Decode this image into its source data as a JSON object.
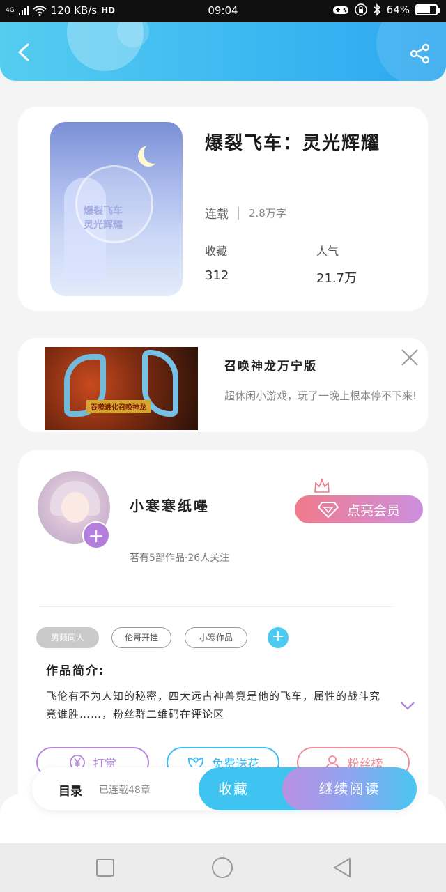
{
  "status_bar": {
    "network": "4G",
    "speed": "120 KB/s",
    "hd": "HD",
    "time": "09:04",
    "battery": "64%",
    "battery_level": 0.64
  },
  "header": {
    "back_icon": "chevron-left-icon",
    "share_icon": "share-icon"
  },
  "book": {
    "title": "爆裂飞车：灵光辉耀",
    "status": "连载",
    "word_count": "2.8万字",
    "collect_label": "收藏",
    "collect_value": "312",
    "popularity_label": "人气",
    "popularity_value": "21.7万",
    "cover_text_line1": "爆裂飞车",
    "cover_text_line2": "灵光辉耀"
  },
  "ad": {
    "title": "召唤神龙万宁版",
    "description": "超休闲小游戏，玩了一晚上根本停不下来!",
    "banner_text": "吞噬进化召唤神龙",
    "close_icon": "close-icon"
  },
  "author": {
    "name": "小寒寒纸嚜",
    "meta": "著有5部作品·26人关注",
    "vip_button": "点亮会员",
    "tags": [
      "男频同人",
      "伦哥开挂",
      "小寒作品"
    ],
    "intro_title": "作品简介:",
    "intro_text": "飞伦有不为人知的秘密，四大远古神兽竟是他的飞车，属性的战斗究竟谁胜……，粉丝群二维码在评论区",
    "actions": {
      "tip": "打赏",
      "flower": "免费送花",
      "fans": "粉丝榜"
    }
  },
  "bottom_bar": {
    "toc_label": "目录",
    "toc_status": "已连载48章",
    "collect_button": "收藏",
    "read_button": "继续阅读"
  },
  "colors": {
    "header": "#3bb6f1",
    "accent_blue": "#3fc4f1",
    "accent_purple": "#b487dc",
    "accent_pink": "#f08a9a"
  }
}
